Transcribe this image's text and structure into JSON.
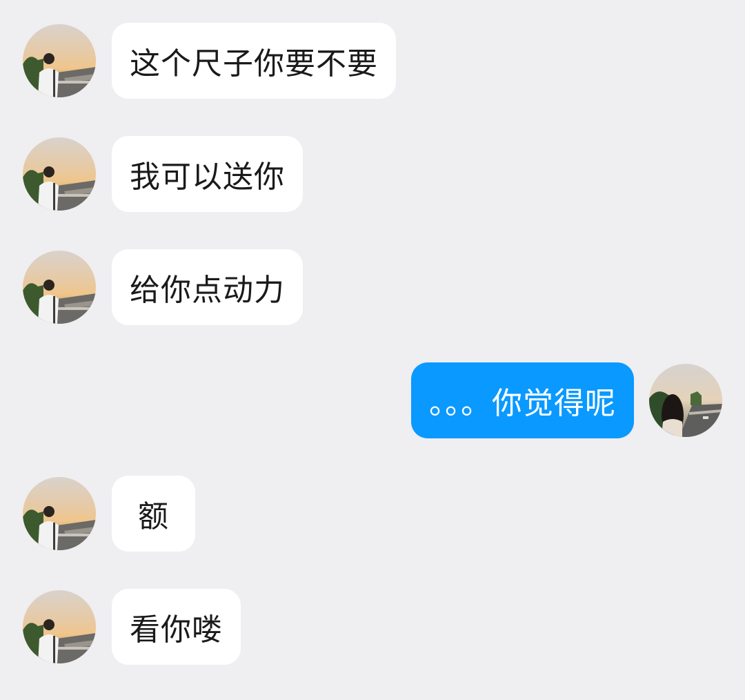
{
  "colors": {
    "page_background": "#EFEEF1",
    "incoming_bubble": "#FFFFFF",
    "outgoing_bubble": "#0A99FF"
  },
  "messages": [
    {
      "sender": "them",
      "avatar": "contact-avatar-icon",
      "text": "这个尺子你要不要"
    },
    {
      "sender": "them",
      "avatar": "contact-avatar-icon",
      "text": "我可以送你"
    },
    {
      "sender": "them",
      "avatar": "contact-avatar-icon",
      "text": "给你点动力"
    },
    {
      "sender": "me",
      "avatar": "self-avatar-icon",
      "text": "。。。你觉得呢"
    },
    {
      "sender": "them",
      "avatar": "contact-avatar-icon",
      "text": "额"
    },
    {
      "sender": "them",
      "avatar": "contact-avatar-icon",
      "text": "看你喽"
    }
  ]
}
